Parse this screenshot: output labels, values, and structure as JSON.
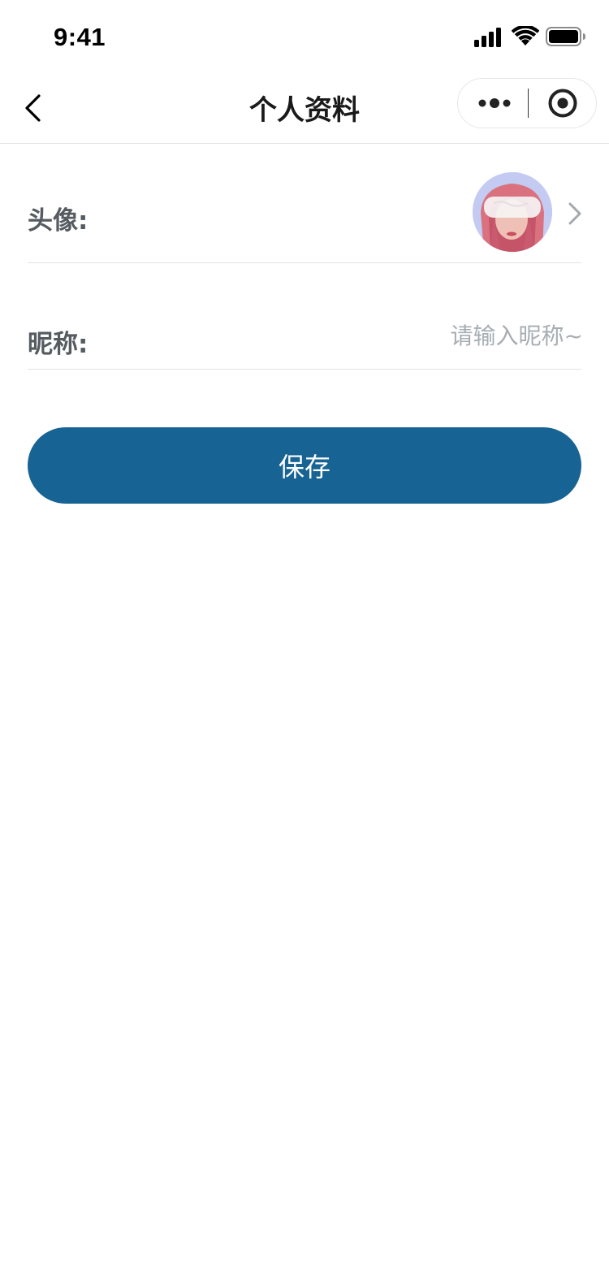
{
  "status_bar": {
    "time": "9:41",
    "icons": [
      "signal-icon",
      "wifi-icon",
      "battery-icon"
    ]
  },
  "nav": {
    "title": "个人资料",
    "icons": [
      "back-icon",
      "more-icon",
      "close-target-icon"
    ]
  },
  "form": {
    "avatar_label": "头像:",
    "nickname_label": "昵称:",
    "nickname_value": "",
    "nickname_placeholder": "请输入昵称~"
  },
  "actions": {
    "save_label": "保存"
  },
  "colors": {
    "primary": "#176393",
    "label": "#555b60",
    "placeholder": "#a6adb3",
    "divider": "#e3e3e3"
  }
}
